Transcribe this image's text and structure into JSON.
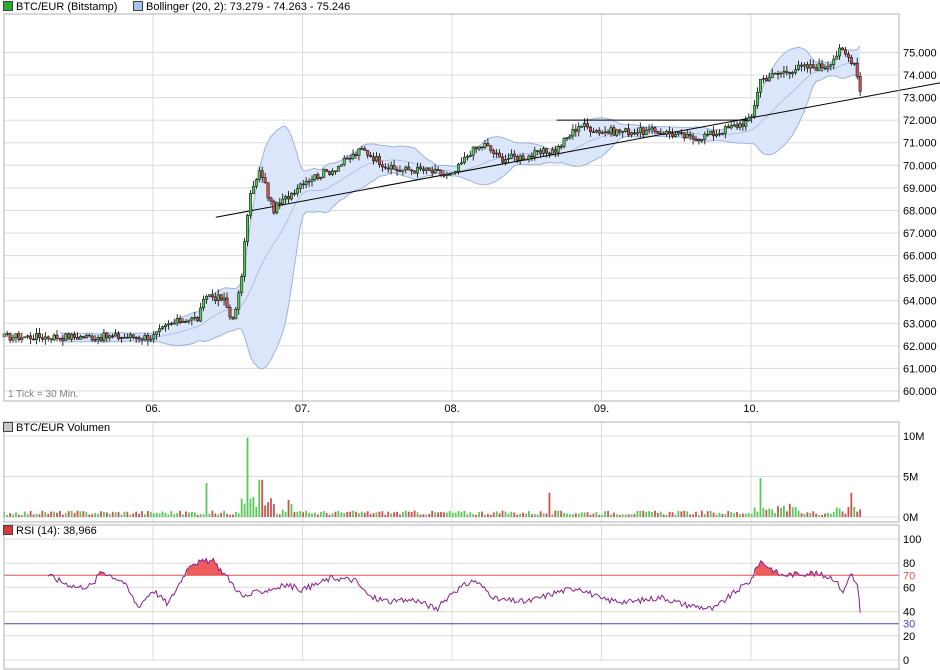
{
  "legend": {
    "price_label": "BTC/EUR (Bitstamp)",
    "bollinger_label": "Bollinger (20, 2): 73.279 - 74.263 - 75.246",
    "volume_label": "BTC/EUR Volumen",
    "rsi_label": "RSI (14): 38,966",
    "tick_note": "1 Tick = 30 Min."
  },
  "colors": {
    "up": "#58c858",
    "down": "#d05050",
    "band_fill": "#dbe6fa",
    "band_line": "#9eb3da",
    "rsi_line": "#8a1f8a",
    "rsi_fill": "#ee5c5c",
    "level70": "#e05050",
    "level30": "#4040d0",
    "grid": "#dcdcdc"
  },
  "chart_data": [
    {
      "type": "candlestick",
      "title": "BTC/EUR (Bitstamp)",
      "x_tick_labels": [
        "06.",
        "07.",
        "08.",
        "09.",
        "10."
      ],
      "y_tick_labels": [
        "60.000",
        "61.000",
        "62.000",
        "63.000",
        "64.000",
        "65.000",
        "66.000",
        "67.000",
        "68.000",
        "69.000",
        "70.000",
        "71.000",
        "72.000",
        "73.000",
        "74.000",
        "75.000"
      ],
      "ylim": [
        59.5,
        75.6
      ],
      "grid": true,
      "bollinger": {
        "period": 20,
        "k": 2,
        "lower": 73.279,
        "middle": 74.263,
        "upper": 75.246
      },
      "trendlines": [
        {
          "from": [
            "06.",
            67.7
          ],
          "to": [
            "10.",
            72.1
          ]
        },
        {
          "from": [
            "08.",
            72.0
          ],
          "to": [
            "10.",
            72.0
          ]
        }
      ],
      "close_path": [
        [
          0.0,
          62.4
        ],
        [
          0.1,
          62.9
        ],
        [
          0.22,
          63.2
        ],
        [
          0.3,
          63.2
        ],
        [
          0.36,
          64.3
        ],
        [
          0.48,
          64.0
        ],
        [
          0.52,
          63.2
        ],
        [
          0.56,
          63.6
        ],
        [
          0.6,
          65.5
        ],
        [
          0.64,
          68.5
        ],
        [
          0.72,
          69.8
        ],
        [
          0.8,
          68.0
        ],
        [
          0.9,
          68.6
        ],
        [
          1.0,
          69.3
        ],
        [
          1.2,
          69.8
        ],
        [
          1.4,
          70.7
        ],
        [
          1.6,
          69.8
        ],
        [
          1.8,
          69.8
        ],
        [
          2.0,
          69.5
        ],
        [
          2.12,
          70.6
        ],
        [
          2.22,
          70.9
        ],
        [
          2.32,
          70.3
        ],
        [
          2.5,
          70.4
        ],
        [
          2.7,
          70.7
        ],
        [
          2.85,
          71.8
        ],
        [
          3.0,
          71.5
        ],
        [
          3.2,
          71.5
        ],
        [
          3.4,
          71.5
        ],
        [
          3.6,
          71.2
        ],
        [
          3.75,
          71.4
        ],
        [
          4.0,
          72.0
        ],
        [
          4.06,
          73.8
        ],
        [
          4.3,
          74.3
        ],
        [
          4.5,
          74.4
        ],
        [
          4.6,
          75.1
        ],
        [
          4.7,
          74.5
        ],
        [
          4.73,
          73.3
        ]
      ]
    },
    {
      "type": "bar",
      "title": "BTC/EUR Volumen",
      "y_tick_labels": [
        "0M",
        "5M",
        "10M"
      ],
      "ylim": [
        0,
        10
      ],
      "peaks": [
        [
          0.64,
          9.8
        ],
        [
          0.72,
          4.6
        ],
        [
          0.36,
          4.2
        ],
        [
          4.06,
          4.8
        ],
        [
          2.65,
          3.0
        ],
        [
          4.67,
          3.0
        ]
      ]
    },
    {
      "type": "line",
      "title": "RSI (14)",
      "y_tick_labels": [
        "0",
        "20",
        "30",
        "40",
        "60",
        "70",
        "80",
        "100"
      ],
      "ylim": [
        0,
        100
      ],
      "levels": [
        30,
        70
      ],
      "series": [
        {
          "name": "RSI (14)",
          "values": [
            [
              -0.7,
              70
            ],
            [
              -0.6,
              64
            ],
            [
              -0.5,
              60
            ],
            [
              -0.4,
              62
            ],
            [
              -0.35,
              74
            ],
            [
              -0.2,
              65
            ],
            [
              -0.1,
              44
            ],
            [
              0.0,
              58
            ],
            [
              0.1,
              46
            ],
            [
              0.25,
              80
            ],
            [
              0.4,
              82
            ],
            [
              0.5,
              68
            ],
            [
              0.6,
              52
            ],
            [
              0.7,
              56
            ],
            [
              0.9,
              62
            ],
            [
              1.0,
              58
            ],
            [
              1.2,
              68
            ],
            [
              1.35,
              66
            ],
            [
              1.45,
              52
            ],
            [
              1.6,
              48
            ],
            [
              1.75,
              50
            ],
            [
              1.9,
              42
            ],
            [
              2.0,
              56
            ],
            [
              2.15,
              66
            ],
            [
              2.3,
              50
            ],
            [
              2.5,
              48
            ],
            [
              2.7,
              56
            ],
            [
              2.85,
              60
            ],
            [
              3.0,
              50
            ],
            [
              3.2,
              48
            ],
            [
              3.4,
              52
            ],
            [
              3.55,
              46
            ],
            [
              3.75,
              42
            ],
            [
              3.85,
              52
            ],
            [
              4.0,
              66
            ],
            [
              4.06,
              82
            ],
            [
              4.2,
              70
            ],
            [
              4.4,
              72
            ],
            [
              4.55,
              68
            ],
            [
              4.62,
              56
            ],
            [
              4.67,
              73
            ],
            [
              4.72,
              58
            ],
            [
              4.73,
              39
            ]
          ]
        }
      ]
    }
  ]
}
